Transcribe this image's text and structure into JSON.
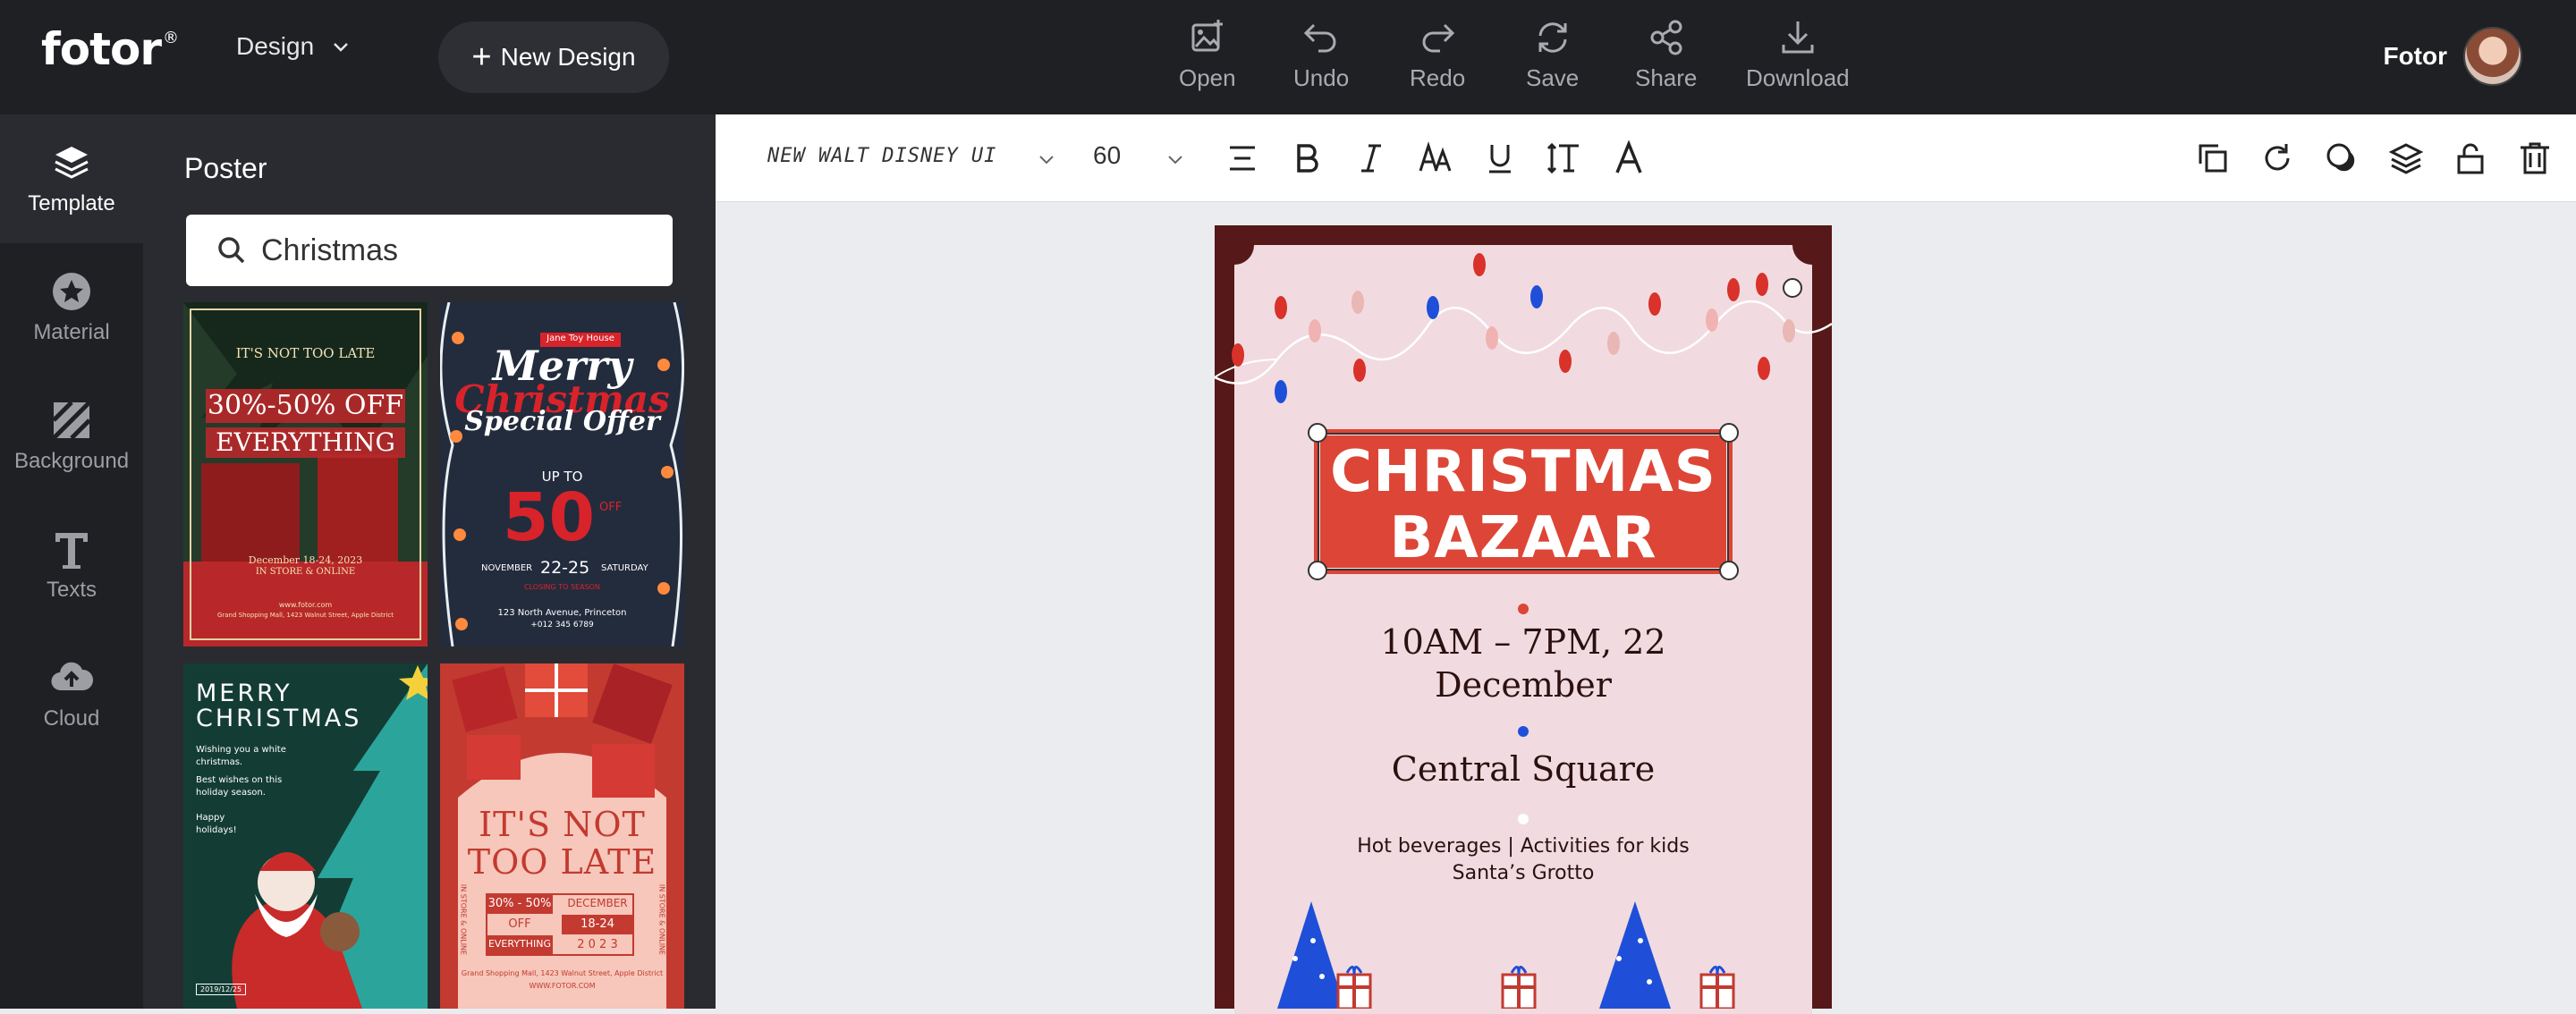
{
  "app": {
    "logo": "fotor",
    "logo_mark": "®",
    "design_menu": "Design",
    "new_design": "New Design",
    "user_name": "Fotor"
  },
  "toolbar": {
    "open": "Open",
    "undo": "Undo",
    "redo": "Redo",
    "save": "Save",
    "share": "Share",
    "download": "Download"
  },
  "nav": [
    {
      "label": "Template",
      "icon": "layers-icon",
      "active": true
    },
    {
      "label": "Material",
      "icon": "star-icon"
    },
    {
      "label": "Background",
      "icon": "background-icon"
    },
    {
      "label": "Texts",
      "icon": "text-icon"
    },
    {
      "label": "Cloud",
      "icon": "cloud-upload-icon"
    }
  ],
  "panel": {
    "title": "Poster",
    "search_value": "Christmas"
  },
  "templates": {
    "t1": {
      "top": "IT'S NOT TOO LATE",
      "l1": "30%-50% OFF",
      "l2": "EVERYTHING",
      "date": "December 18-24, 2023",
      "store": "IN STORE & ONLINE",
      "url": "www.fotor.com",
      "addr": "Grand Shopping Mall, 1423 Walnut Street, Apple District"
    },
    "t2": {
      "house": "Jane Toy House",
      "merry": "Merry",
      "christmas": "Christmas",
      "special": "Special Offer",
      "upto": "UP TO",
      "fifty": "50",
      "off": "OFF",
      "nov": "NOVEMBER",
      "days": "22-25",
      "sat": "SATURDAY",
      "closing": "CLOSING TO SEASON",
      "addr": "123 North Avenue, Princeton",
      "phone": "+012 345 6789"
    },
    "t3": {
      "l1": "MERRY",
      "l2": "CHRISTMAS",
      "wish": "Wishing you a white christmas.",
      "best": "Best wishes on this holiday season.",
      "happy": "Happy holidays!",
      "date": "2019/12/25"
    },
    "t4": {
      "l1": "IT'S NOT",
      "l2": "TOO LATE",
      "pct": "30% - 50%",
      "off": "OFF",
      "every": "EVERYTHING",
      "dec": "DECEMBER",
      "days": "18-24",
      "year": "2 0 2 3",
      "side1": "IN STORE & ONLINE",
      "side2": "IN STORE & ONLINE",
      "addr": "Grand Shopping Mall, 1423 Walnut Street, Apple District",
      "url": "WWW.FOTOR.COM"
    }
  },
  "format": {
    "font": "NEW WALT DISNEY UI",
    "size": "60"
  },
  "poster": {
    "title_line1": "CHRISTMAS",
    "title_line2": "BAZAAR",
    "time_line1": "10AM – 7PM, 22",
    "time_line2": "December",
    "place": "Central Square",
    "info_line1": "Hot beverages | Activities for kids",
    "info_line2": "Santa’s Grotto"
  },
  "colors": {
    "accent_red": "#dd4536",
    "poster_frame": "#561818",
    "poster_bg": "#f1dbe0",
    "topbar": "#1f2024"
  }
}
